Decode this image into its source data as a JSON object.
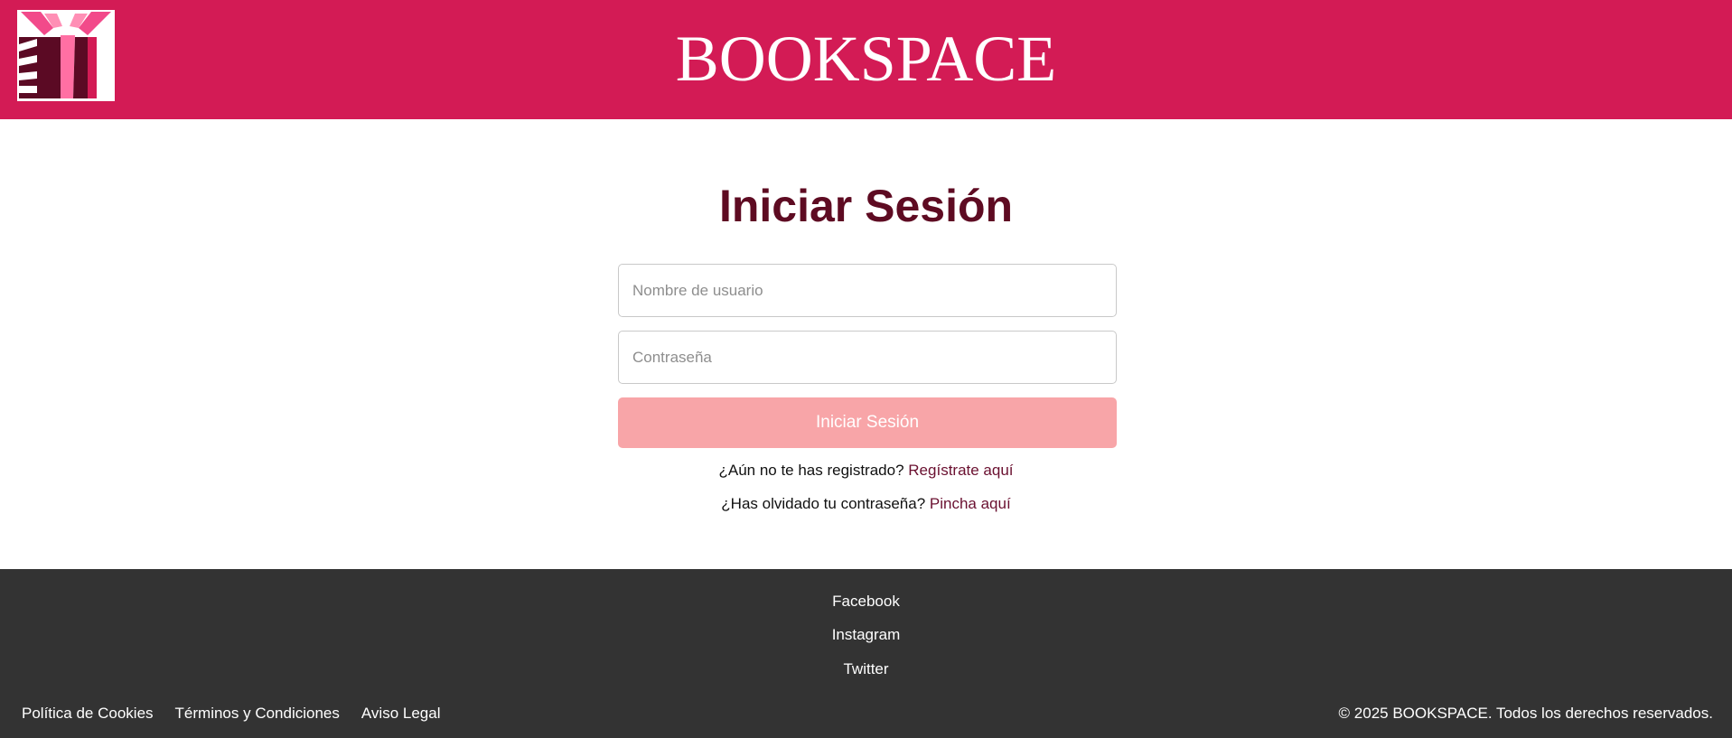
{
  "header": {
    "site_title": "BOOKSPACE",
    "brand_color": "#d31b55",
    "logo_icon": "open-book-icon"
  },
  "login": {
    "title": "Iniciar Sesión",
    "username_placeholder": "Nombre de usuario",
    "password_placeholder": "Contraseña",
    "submit_label": "Iniciar Sesión",
    "register_prompt": "¿Aún no te has registrado?",
    "register_link": "Regístrate aquí",
    "forgot_prompt": "¿Has olvidado tu contraseña?",
    "forgot_link": "Pincha aquí"
  },
  "footer": {
    "social": [
      "Facebook",
      "Instagram",
      "Twitter"
    ],
    "legal_links": [
      "Política de Cookies",
      "Términos y Condiciones",
      "Aviso Legal"
    ],
    "copyright": "© 2025 BOOKSPACE. Todos los derechos reservados.",
    "background_color": "#333333"
  }
}
